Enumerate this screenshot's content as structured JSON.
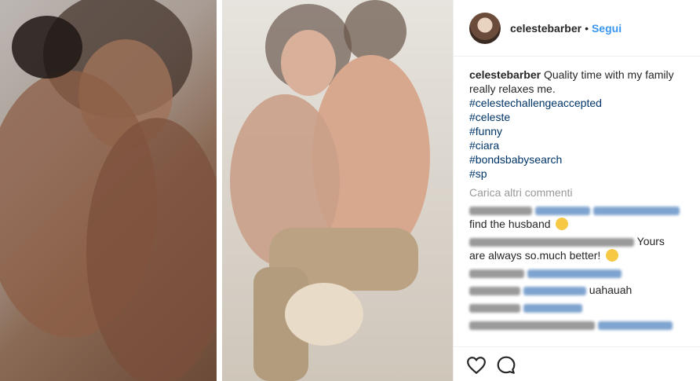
{
  "post": {
    "author": {
      "username": "celestebarber",
      "separator": "•",
      "follow_label": "Segui"
    },
    "caption": {
      "username": "celestebarber",
      "text": "Quality time with my family really relaxes me.",
      "hashtags": [
        "#celestechallengeaccepted",
        "#celeste",
        "#funny",
        "#ciara",
        "#bondsbabysearch",
        "#sp"
      ]
    },
    "load_more_label": "Carica altri commenti",
    "comments": [
      {
        "text": "find the husband"
      },
      {
        "text": "Yours"
      },
      {
        "text": "are always so.much better!"
      },
      {
        "text": ""
      },
      {
        "text": "uahauah"
      },
      {
        "text": ""
      },
      {
        "text": ""
      }
    ],
    "actions": {
      "like_icon": "heart-icon",
      "comment_icon": "comment-bubble-icon"
    }
  },
  "colors": {
    "link_blue": "#3897f0",
    "hashtag_blue": "#003569",
    "muted": "#999999",
    "text": "#262626"
  }
}
